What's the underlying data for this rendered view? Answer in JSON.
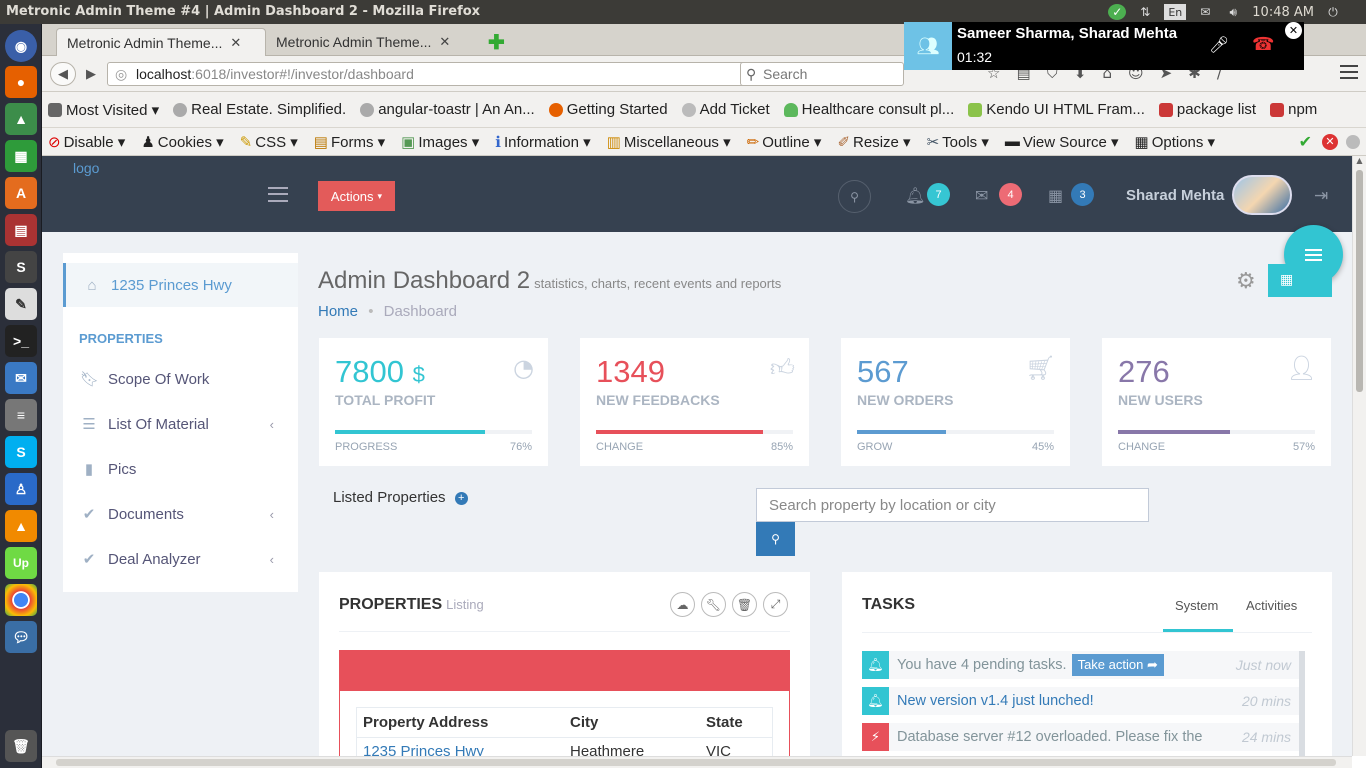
{
  "os": {
    "window_title": "Metronic Admin Theme #4 | Admin Dashboard 2 - Mozilla Firefox",
    "kbd_layout": "En",
    "clock": "10:48 AM"
  },
  "browser": {
    "tabs": [
      {
        "label": "Metronic Admin Theme..."
      },
      {
        "label": "Metronic Admin Theme..."
      }
    ],
    "url_host": "localhost",
    "url_rest": ":6018/investor#!/investor/dashboard",
    "search_placeholder": "Search",
    "bookmarks": [
      {
        "label": "Most Visited ▾",
        "color": "#4a4a4a"
      },
      {
        "label": "Real Estate. Simplified.",
        "color": "#888888"
      },
      {
        "label": "angular-toastr | An An...",
        "color": "#888888"
      },
      {
        "label": "Getting Started",
        "color": "#e66000"
      },
      {
        "label": "Add Ticket",
        "color": "#aaaaaa"
      },
      {
        "label": "Healthcare consult pl...",
        "color": "#5cb85c"
      },
      {
        "label": "Kendo UI HTML Fram...",
        "color": "#8bc34a"
      },
      {
        "label": "package list",
        "color": "#cb3837"
      },
      {
        "label": "npm",
        "color": "#cb3837"
      }
    ],
    "webdev_items": [
      {
        "label": "Disable ▾",
        "icon": "⊘",
        "color": "#d00"
      },
      {
        "label": "Cookies ▾",
        "icon": "♟",
        "color": "#333"
      },
      {
        "label": "CSS ▾",
        "icon": "✎",
        "color": "#c90"
      },
      {
        "label": "Forms ▾",
        "icon": "▤",
        "color": "#b70"
      },
      {
        "label": "Images ▾",
        "icon": "▣",
        "color": "#595"
      },
      {
        "label": "Information ▾",
        "icon": "ℹ",
        "color": "#36c"
      },
      {
        "label": "Miscellaneous ▾",
        "icon": "▥",
        "color": "#c80"
      },
      {
        "label": "Outline ▾",
        "icon": "✏",
        "color": "#c60"
      },
      {
        "label": "Resize ▾",
        "icon": "✐",
        "color": "#a63"
      },
      {
        "label": "Tools ▾",
        "icon": "✂",
        "color": "#456"
      },
      {
        "label": "View Source ▾",
        "icon": "▬",
        "color": "#333"
      },
      {
        "label": "Options ▾",
        "icon": "▦",
        "color": "#555"
      }
    ]
  },
  "call": {
    "names": "Sameer Sharma, Sharad Mehta",
    "duration": "01:32"
  },
  "app": {
    "logo": "logo",
    "actions_label": "Actions",
    "notifications": {
      "bell": "7",
      "inbox": "4",
      "calendar": "3"
    },
    "user_name": "Sharad Mehta",
    "sidebar": {
      "top_item": "1235 Princes Hwy",
      "section": "PROPERTIES",
      "items": [
        {
          "label": "Scope Of Work",
          "icon": "bookmark-icon",
          "chevron": false
        },
        {
          "label": "List Of Material",
          "icon": "list-icon",
          "chevron": true
        },
        {
          "label": "Pics",
          "icon": "file-icon",
          "chevron": false
        },
        {
          "label": "Documents",
          "icon": "check-circle-icon",
          "chevron": true
        },
        {
          "label": "Deal Analyzer",
          "icon": "check-circle-icon",
          "chevron": true
        }
      ]
    },
    "page_title": "Admin Dashboard 2",
    "page_subtitle": "statistics, charts, recent events and reports",
    "breadcrumb": {
      "home": "Home",
      "current": "Dashboard"
    },
    "stats": [
      {
        "value": "7800",
        "unit": "$",
        "label": "TOTAL PROFIT",
        "progress_label": "PROGRESS",
        "percent": 76,
        "percent_text": "76%",
        "color": "#32c5d2"
      },
      {
        "value": "1349",
        "unit": "",
        "label": "NEW FEEDBACKS",
        "progress_label": "CHANGE",
        "percent": 85,
        "percent_text": "85%",
        "color": "#e7505a"
      },
      {
        "value": "567",
        "unit": "",
        "label": "NEW ORDERS",
        "progress_label": "GROW",
        "percent": 45,
        "percent_text": "45%",
        "color": "#5c9bd1"
      },
      {
        "value": "276",
        "unit": "",
        "label": "NEW USERS",
        "progress_label": "CHANGE",
        "percent": 57,
        "percent_text": "57%",
        "color": "#8877a9"
      }
    ],
    "listed_properties": "Listed Properties",
    "property_search_placeholder": "Search property by location or city",
    "properties_portlet": {
      "title": "PROPERTIES",
      "subtitle": "Listing",
      "columns": [
        "Property Address",
        "City",
        "State"
      ],
      "row": [
        "1235 Princes Hwy",
        "Heathmere",
        "VIC"
      ]
    },
    "tasks_portlet": {
      "title": "TASKS",
      "tabs": [
        "System",
        "Activities"
      ],
      "items": [
        {
          "text": "You have 4 pending tasks.",
          "action": "Take action",
          "time": "Just now",
          "color": "#32c5d2",
          "icon": "bell-icon"
        },
        {
          "text": "New version v1.4 just lunched!",
          "action": "",
          "time": "20 mins",
          "color": "#32c5d2",
          "icon": "bell-icon"
        },
        {
          "text": "Database server #12 overloaded. Please fix the",
          "action": "",
          "time": "24 mins",
          "color": "#e7505a",
          "icon": "bolt-icon"
        }
      ]
    }
  }
}
